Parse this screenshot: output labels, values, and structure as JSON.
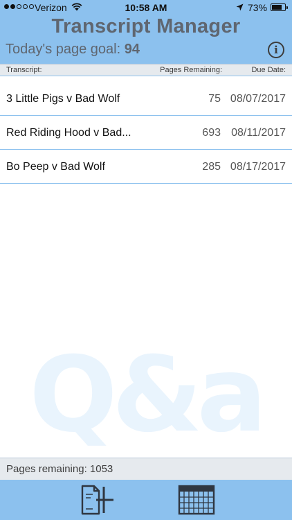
{
  "status_bar": {
    "carrier": "Verizon",
    "time": "10:58 AM",
    "battery": "73%"
  },
  "header": {
    "title": "Transcript Manager",
    "goal_label": "Today's page goal:",
    "goal_value": "94",
    "info_glyph": "i"
  },
  "columns": {
    "transcript": "Transcript:",
    "pages_remaining": "Pages Remaining:",
    "due_date": "Due Date:"
  },
  "transcripts": [
    {
      "name": "3 Little Pigs v Bad Wolf",
      "pages": "75",
      "due": "08/07/2017"
    },
    {
      "name": "Red Riding Hood v Bad...",
      "pages": "693",
      "due": "08/11/2017"
    },
    {
      "name": "Bo Peep v Bad Wolf",
      "pages": "285",
      "due": "08/17/2017"
    }
  ],
  "watermark": "Q&a",
  "footer": {
    "summary": "Pages remaining: 1053"
  },
  "toolbar": {
    "add_icon": "add-transcript-icon",
    "calendar_icon": "calendar-icon"
  },
  "colors": {
    "header_bg": "#8cc1ee",
    "title_text": "#5f6670",
    "row_divider": "#8cc1ee",
    "header_row_bg": "#e6eaee",
    "watermark": "#e9f4fd"
  }
}
